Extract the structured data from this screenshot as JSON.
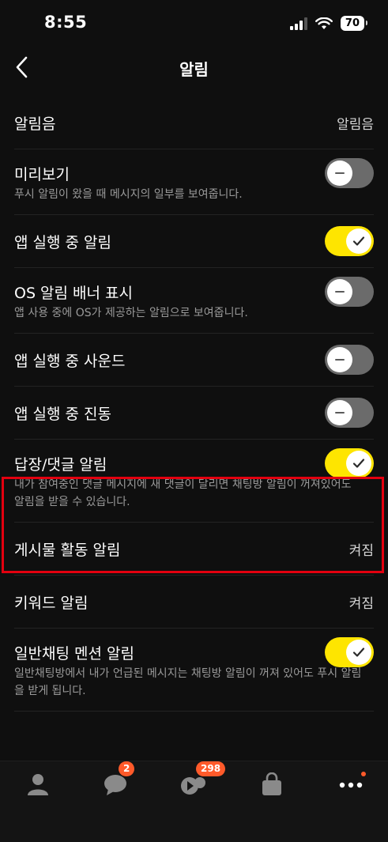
{
  "status_bar": {
    "time": "8:55",
    "battery": "70"
  },
  "nav": {
    "title": "알림"
  },
  "settings": [
    {
      "id": "sound",
      "label": "알림음",
      "value": "알림음"
    },
    {
      "id": "preview",
      "label": "미리보기",
      "toggle": "off",
      "desc": "푸시 알림이 왔을 때 메시지의 일부를 보여줍니다."
    },
    {
      "id": "in-app",
      "label": "앱 실행 중 알림",
      "toggle": "on"
    },
    {
      "id": "os-banner",
      "label": "OS 알림 배너 표시",
      "toggle": "off",
      "desc": "앱 사용 중에 OS가 제공하는 알림으로 보여줍니다."
    },
    {
      "id": "in-app-sound",
      "label": "앱 실행 중 사운드",
      "toggle": "off"
    },
    {
      "id": "in-app-vibration",
      "label": "앱 실행 중 진동",
      "toggle": "off"
    },
    {
      "id": "reply",
      "label": "답장/댓글 알림",
      "toggle": "on",
      "desc": "내가 참여중인 댓글 메시지에 새 댓글이 달리면 채팅방 알림이 꺼져있어도 알림을 받을 수 있습니다."
    },
    {
      "id": "post-activity",
      "label": "게시물 활동 알림",
      "value": "켜짐"
    },
    {
      "id": "keyword",
      "label": "키워드 알림",
      "value": "켜짐"
    },
    {
      "id": "mention",
      "label": "일반채팅 멘션 알림",
      "toggle": "on",
      "desc": "일반채팅방에서 내가 언급된 메시지는 채팅방 알림이 꺼져 있어도 푸시 알림을 받게 됩니다."
    }
  ],
  "tab_bar": {
    "chats_badge": "2",
    "openchat_badge": "298"
  },
  "colors": {
    "toggle_on": "#fee500",
    "toggle_off": "#6b6b6b",
    "badge": "#ff5a2a",
    "highlight": "#e3000f"
  }
}
